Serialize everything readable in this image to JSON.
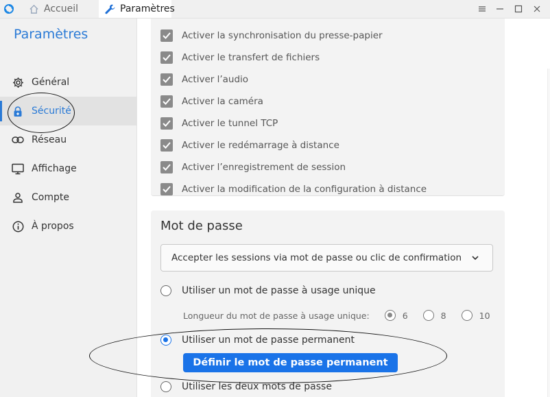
{
  "titlebar": {
    "tabs": [
      {
        "label": "Accueil",
        "icon": "home-icon"
      },
      {
        "label": "Paramètres",
        "icon": "wrench-icon"
      }
    ],
    "controls": [
      "menu-icon",
      "minimize-icon",
      "maximize-icon",
      "close-icon"
    ]
  },
  "sidebar": {
    "title": "Paramètres",
    "items": [
      {
        "label": "Général",
        "icon": "gear-icon"
      },
      {
        "label": "Sécurité",
        "icon": "lock-icon"
      },
      {
        "label": "Réseau",
        "icon": "link-icon"
      },
      {
        "label": "Affichage",
        "icon": "monitor-icon"
      },
      {
        "label": "Compte",
        "icon": "user-icon"
      },
      {
        "label": "À propos",
        "icon": "info-icon"
      }
    ],
    "active_index": 1
  },
  "permissions": {
    "items": [
      {
        "label": "Activer la synchronisation du presse-papier",
        "checked": true
      },
      {
        "label": "Activer le transfert de fichiers",
        "checked": true
      },
      {
        "label": "Activer l’audio",
        "checked": true
      },
      {
        "label": "Activer la caméra",
        "checked": true
      },
      {
        "label": "Activer le tunnel TCP",
        "checked": true
      },
      {
        "label": "Activer le redémarrage à distance",
        "checked": true
      },
      {
        "label": "Activer l’enregistrement de session",
        "checked": true
      },
      {
        "label": "Activer la modification de la configuration à distance",
        "checked": true
      }
    ]
  },
  "password": {
    "title": "Mot de passe",
    "approve_mode": "Accepter les sessions via mot de passe ou clic de confirmation",
    "options": {
      "one_time": "Utiliser un mot de passe à usage unique",
      "length_label": "Longueur du mot de passe à usage unique:",
      "lengths": [
        "6",
        "8",
        "10"
      ],
      "selected_length": "6",
      "permanent": "Utiliser un mot de passe permanent",
      "both": "Utiliser les deux mots de passe"
    },
    "selected_option": "permanent",
    "set_permanent_button": "Définir le mot de passe permanent"
  },
  "colors": {
    "accent": "#1a73e8",
    "sidebar_title": "#2a7ad6",
    "checkbox": "#8a8a8a"
  }
}
